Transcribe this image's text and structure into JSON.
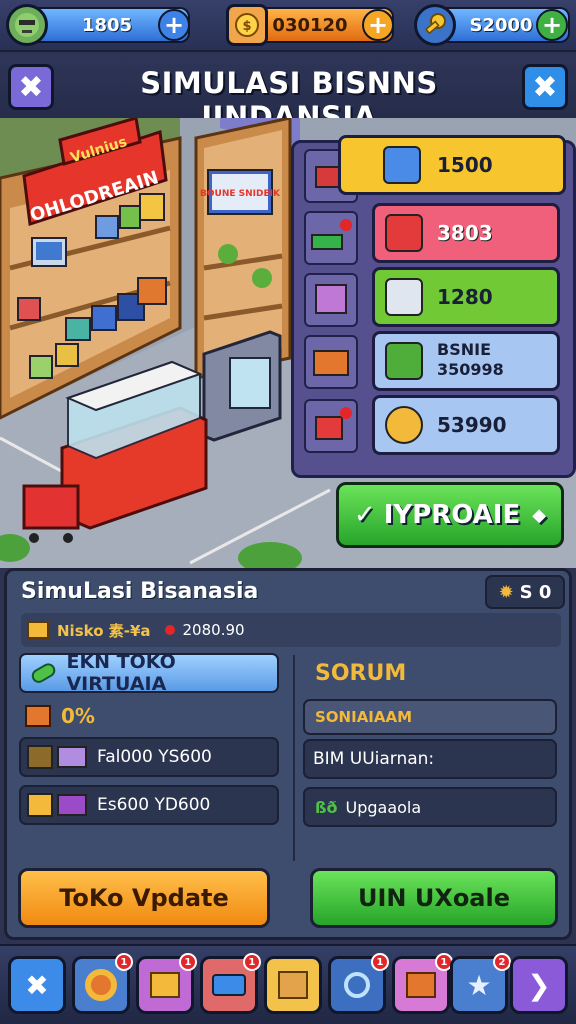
{
  "resources": [
    {
      "value": "1805",
      "icon": "zombie-avatar-icon"
    },
    {
      "value": "030120",
      "icon": "coin-stack-icon"
    },
    {
      "value": "S2000",
      "icon": "gold-key-icon"
    }
  ],
  "title": "SIMULASI BISNNS IINDANSIA",
  "store": {
    "sign_main": "OHLODREAIN",
    "sign_top": "Vulnius",
    "poster": "BOUNE SNIDEIK"
  },
  "upgrades_panel": {
    "items": [
      {
        "value": "1500",
        "color": "#f7c52e",
        "icon": "blue-box-icon"
      },
      {
        "value": "3803",
        "color": "#f0607a",
        "icon": "red-gift-icon"
      },
      {
        "value": "1280",
        "color": "#72c936",
        "icon": "fridge-icon"
      },
      {
        "value_line1": "BSNIE",
        "value_line2": "350998",
        "color": "#a8c6f2",
        "icon": "green-crate-icon"
      },
      {
        "value": "53990",
        "color": "#a8c6f2",
        "icon": "gold-gear-icon"
      }
    ],
    "upgrade_button": "IYPROAIE"
  },
  "info": {
    "title": "SimuLasi Bisanasia",
    "badge_value": "S 0",
    "subline_label": "Nisko 素-¥a",
    "subline_value": "2080.90",
    "tab_label": "EKN TOKO VIRTUAIA",
    "left_rows": [
      {
        "text": "0%"
      },
      {
        "text": "Fal000 YS600"
      },
      {
        "text": "Es600 YD600"
      }
    ],
    "right_header": "SORUM",
    "right_rows": [
      {
        "text": "SONIAIAAM"
      },
      {
        "text": "BIM UUiarnan:"
      },
      {
        "prefix": "ßð",
        "text": "Upgaaola"
      }
    ],
    "btn_left": "ToKo Vpdate",
    "btn_right": "UIN UXoale"
  },
  "bottom_nav": [
    {
      "icon": "close-icon",
      "badge": ""
    },
    {
      "icon": "target-icon",
      "badge": "1"
    },
    {
      "icon": "box-icon",
      "badge": "1"
    },
    {
      "icon": "truck-icon",
      "badge": "1"
    },
    {
      "icon": "package-icon",
      "badge": ""
    },
    {
      "icon": "search-icon",
      "badge": "1"
    },
    {
      "icon": "gift-box-icon",
      "badge": "1"
    },
    {
      "icon": "star-icon",
      "badge": "2"
    },
    {
      "icon": "next-arrow-icon",
      "badge": ""
    }
  ]
}
